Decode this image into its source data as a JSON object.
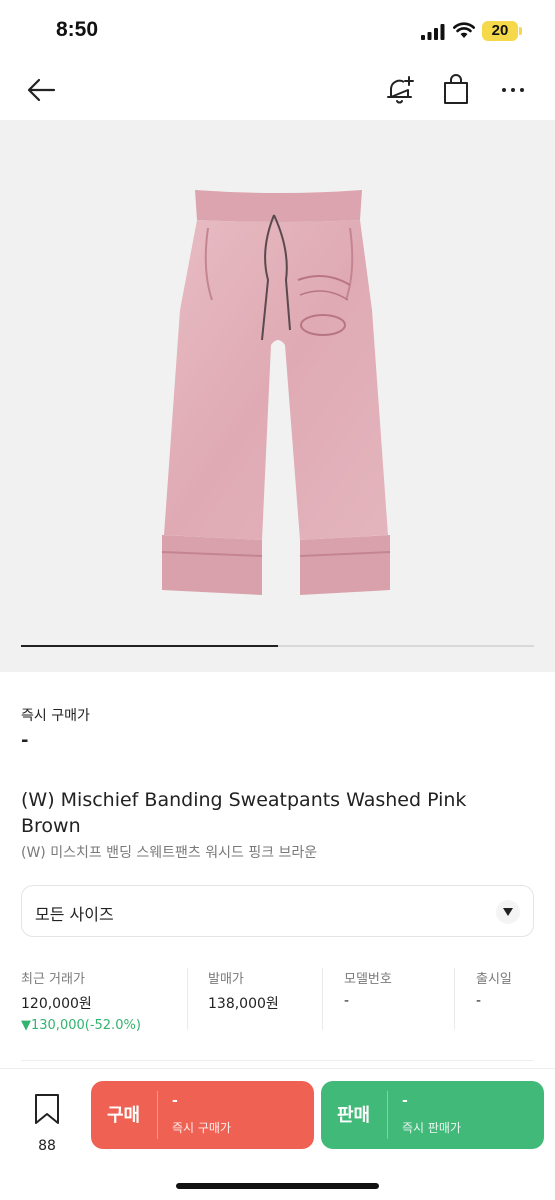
{
  "status_bar": {
    "time": "8:50",
    "battery": "20",
    "icons": [
      "signal-icon",
      "wifi-icon",
      "battery-icon"
    ]
  },
  "nav": {
    "icons": [
      "back-arrow-icon",
      "bell-plus-icon",
      "shopping-bag-icon",
      "more-dots-icon"
    ]
  },
  "product_image": {
    "alt": "Pink washed sweatpants",
    "slider_progress": 0.5
  },
  "price": {
    "label": "즉시 구매가",
    "value": "-"
  },
  "product": {
    "title_en": "(W) Mischief Banding Sweatpants Washed Pink Brown",
    "title_ko": "(W) 미스치프 밴딩 스웨트팬츠 워시드 핑크 브라운"
  },
  "size_select": {
    "value": "모든 사이즈"
  },
  "info": {
    "recent": {
      "label": "최근 거래가",
      "value": "120,000원",
      "change": "▼130,000(-52.0%)"
    },
    "release_price": {
      "label": "발매가",
      "value": "138,000원"
    },
    "model": {
      "label": "모델번호",
      "value": "-"
    },
    "release_date": {
      "label": "출시일",
      "value": "-"
    }
  },
  "bottom_bar": {
    "wish_count": "88",
    "buy": {
      "label": "구매",
      "price": "-",
      "sub": "즉시 구매가"
    },
    "sell": {
      "label": "판매",
      "price": "-",
      "sub": "즉시 판매가"
    }
  },
  "colors": {
    "buy": "#ef6253",
    "sell": "#41b979",
    "price_drop": "#31b46e",
    "image_bg": "#f1f1f1"
  }
}
